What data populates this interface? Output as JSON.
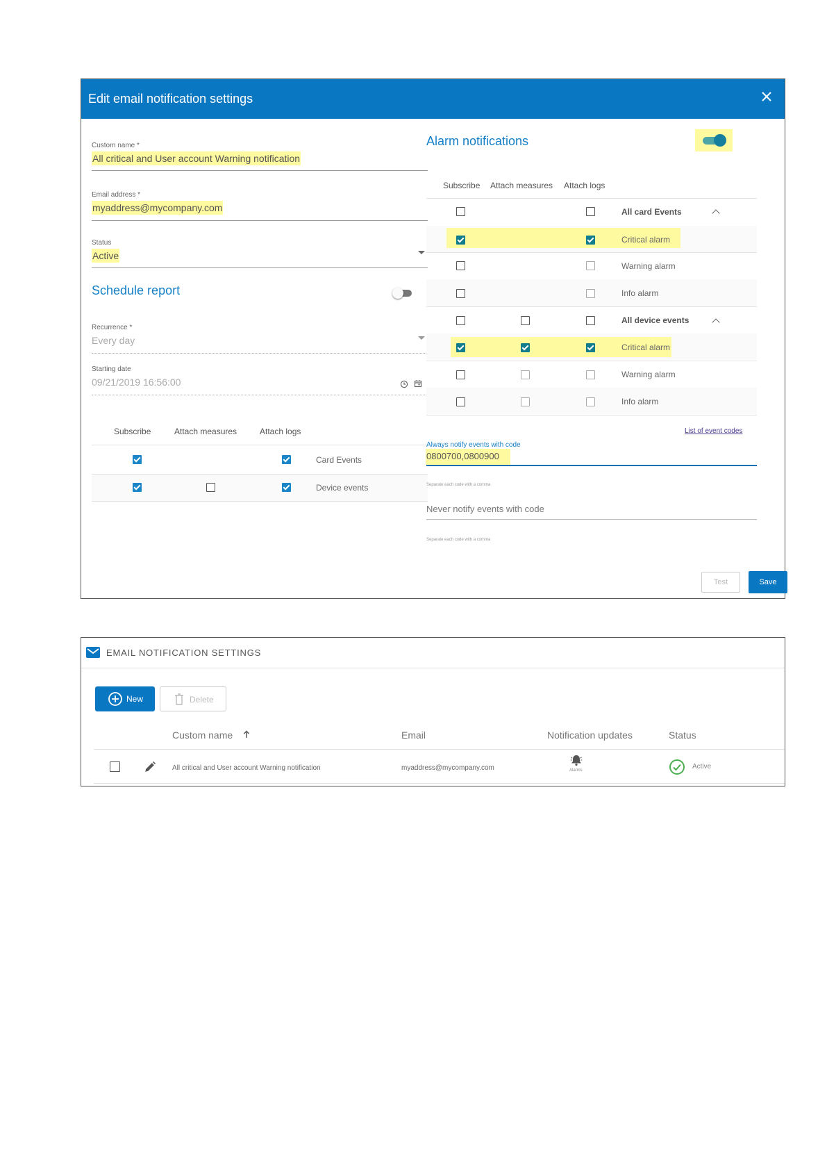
{
  "dialog": {
    "title": "Edit email notification settings",
    "close_icon": "close-icon",
    "custom_name": {
      "label": "Custom name *",
      "value": "All critical and User account Warning notification"
    },
    "email": {
      "label": "Email address *",
      "value": "myaddress@mycompany.com"
    },
    "status": {
      "label": "Status",
      "value": "Active"
    },
    "schedule": {
      "title": "Schedule report",
      "enabled": false,
      "recurrence": {
        "label": "Recurrence *",
        "value": "Every day"
      },
      "starting_date": {
        "label": "Starting date",
        "value": "09/21/2019 16:56:00"
      },
      "columns": [
        "Subscribe",
        "Attach measures",
        "Attach logs"
      ],
      "rows": [
        {
          "label": "Card Events",
          "subscribe": true,
          "measures": null,
          "logs": true
        },
        {
          "label": "Device events",
          "subscribe": true,
          "measures": false,
          "logs": true
        }
      ]
    },
    "alarms": {
      "title": "Alarm notifications",
      "enabled": true,
      "columns": [
        "Subscribe",
        "Attach measures",
        "Attach logs"
      ],
      "groups": [
        {
          "label": "All card Events",
          "subscribe": false,
          "measures": null,
          "logs": false,
          "items": [
            {
              "label": "Critical alarm",
              "subscribe": true,
              "measures": null,
              "logs": true,
              "highlight": true
            },
            {
              "label": "Warning alarm",
              "subscribe": false,
              "measures": null,
              "logs": false
            },
            {
              "label": "Info alarm",
              "subscribe": false,
              "measures": null,
              "logs": false
            }
          ]
        },
        {
          "label": "All device events",
          "subscribe": false,
          "measures": false,
          "logs": false,
          "items": [
            {
              "label": "Critical alarm",
              "subscribe": true,
              "measures": true,
              "logs": true,
              "highlight": true
            },
            {
              "label": "Warning alarm",
              "subscribe": false,
              "measures": false,
              "logs": false
            },
            {
              "label": "Info alarm",
              "subscribe": false,
              "measures": false,
              "logs": false
            }
          ]
        }
      ],
      "event_codes_link": "List of event codes",
      "always_notify": {
        "label": "Always notify events with code",
        "value": "0800700,0800900",
        "hint": "Separate each code with a comma"
      },
      "never_notify": {
        "placeholder": "Never notify events with code",
        "hint": "Separate each code with a comma"
      }
    },
    "buttons": {
      "test": "Test",
      "save": "Save"
    }
  },
  "panel": {
    "title": "EMAIL NOTIFICATION SETTINGS",
    "icon": "mail-icon",
    "buttons": {
      "new": "New",
      "delete": "Delete"
    },
    "columns": [
      "Custom name",
      "Email",
      "Notification updates",
      "Status"
    ],
    "rows": [
      {
        "name": "All critical and User account Warning notification",
        "email": "myaddress@mycompany.com",
        "updates_label": "Alarms",
        "status": "Active"
      }
    ]
  },
  "colors": {
    "primary": "#0a77c2",
    "highlight": "#fdfaa0",
    "teal": "#117d8c",
    "success": "#4caf50"
  }
}
